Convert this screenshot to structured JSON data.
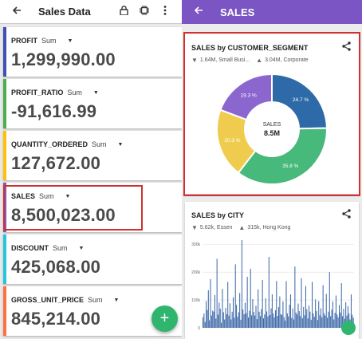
{
  "left": {
    "appbar": {
      "back_icon": "arrow-left-icon",
      "title": "Sales Data",
      "lock_icon": "lock-icon",
      "chip_icon": "chip-icon",
      "menu_icon": "more-vertical-icon"
    },
    "kpis": [
      {
        "name": "PROFIT",
        "agg": "Sum",
        "value": "1,299,990.00",
        "color": "#3f51b5"
      },
      {
        "name": "PROFIT_RATIO",
        "agg": "Sum",
        "value": "-91,616.99",
        "color": "#4caf50"
      },
      {
        "name": "QUANTITY_ORDERED",
        "agg": "Sum",
        "value": "127,672.00",
        "color": "#ffc107"
      },
      {
        "name": "SALES",
        "agg": "Sum",
        "value": "8,500,023.00",
        "color": "#7e57c2"
      },
      {
        "name": "DISCOUNT",
        "agg": "Sum",
        "value": "425,068.00",
        "color": "#26c6da"
      },
      {
        "name": "GROSS_UNIT_PRICE",
        "agg": "Sum",
        "value": "845,214.00",
        "color": "#ff7043"
      }
    ],
    "fab": {
      "icon": "plus-icon",
      "label": "+"
    }
  },
  "right": {
    "appbar": {
      "back_icon": "arrow-left-icon",
      "title": "SALES"
    },
    "segment_card": {
      "title": "SALES by CUSTOMER_SEGMENT",
      "min_stat": "1.64M, Small Busi...",
      "max_stat": "3.04M, Corporate",
      "center_label": "SALES",
      "center_value": "8.5M"
    },
    "city_card": {
      "title": "SALES by CITY",
      "min_stat": "5.62k, Essen",
      "max_stat": "315k, Hong Kong"
    }
  },
  "chart_data": [
    {
      "type": "pie",
      "title": "SALES by CUSTOMER_SEGMENT",
      "center_label": "SALES",
      "center_value": "8.5M",
      "slices": [
        {
          "label": "Corporate",
          "value": 24.7,
          "display": "24.7 %",
          "color": "#2e6aa8"
        },
        {
          "label": "",
          "value": 35.8,
          "display": "35.8 %",
          "color": "#47b97a"
        },
        {
          "label": "",
          "value": 20.3,
          "display": "20.3 %",
          "color": "#f0cc4e"
        },
        {
          "label": "Small Business",
          "value": 19.3,
          "display": "19.3 %",
          "color": "#8c66cf"
        }
      ]
    },
    {
      "type": "bar",
      "title": "SALES by CITY",
      "ylim": [
        0,
        315000
      ],
      "y_ticks": [
        "300k",
        "200k",
        "100k",
        "0"
      ],
      "color": "#3b67a7",
      "values": [
        38000,
        52000,
        21000,
        96000,
        64000,
        135000,
        27000,
        175000,
        44000,
        62000,
        58000,
        118000,
        33000,
        248000,
        47000,
        91000,
        69000,
        18000,
        140000,
        56000,
        30000,
        72000,
        49000,
        165000,
        44000,
        88000,
        30000,
        58000,
        110000,
        36000,
        228000,
        83000,
        40000,
        56000,
        125000,
        29000,
        315000,
        66000,
        49000,
        90000,
        52000,
        183000,
        37000,
        61000,
        212000,
        45000,
        103000,
        57000,
        44000,
        79000,
        31000,
        138000,
        58000,
        42000,
        67000,
        172000,
        34000,
        48000,
        106000,
        59000,
        41000,
        255000,
        46000,
        70000,
        120000,
        52000,
        38000,
        63000,
        168000,
        43000,
        74000,
        113000,
        49000,
        47000,
        95000,
        38000,
        26000,
        168000,
        52000,
        41000,
        83000,
        120000,
        36000,
        70000,
        30000,
        220000,
        55000,
        48000,
        87000,
        60000,
        42000,
        178000,
        34000,
        75000,
        45000,
        150000,
        67000,
        34000,
        80000,
        58000,
        29000,
        165000,
        52000,
        40000,
        102000,
        60000,
        28000,
        96000,
        45000,
        70000,
        38000,
        153000,
        52000,
        44000,
        122000,
        36000,
        58000,
        200000,
        42000,
        65000,
        95000,
        30000,
        54000,
        116000,
        48000,
        38000,
        82000,
        55000,
        160000,
        42000,
        68000,
        33000,
        92000,
        44000,
        78000,
        52000,
        30000,
        120000,
        47000,
        36000
      ]
    }
  ]
}
